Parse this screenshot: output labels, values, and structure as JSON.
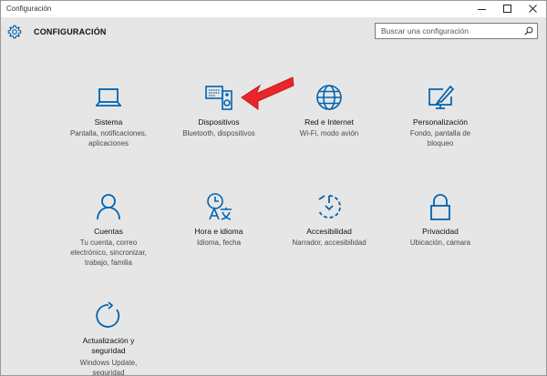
{
  "window": {
    "title": "Configuración"
  },
  "header": {
    "title": "CONFIGURACIÓN",
    "search_placeholder": "Buscar una configuración"
  },
  "colors": {
    "accent": "#0063b1",
    "arrow": "#e8262b"
  },
  "tiles": [
    {
      "icon": "laptop-icon",
      "label": "Sistema",
      "desc": [
        "Pantalla, notificaciones,",
        "aplicaciones"
      ]
    },
    {
      "icon": "devices-icon",
      "label": "Dispositivos",
      "desc": [
        "Bluetooth, dispositivos"
      ]
    },
    {
      "icon": "globe-icon",
      "label": "Red e Internet",
      "desc": [
        "Wi-Fi, modo avión"
      ]
    },
    {
      "icon": "paint-icon",
      "label": "Personalización",
      "desc": [
        "Fondo, pantalla de",
        "bloqueo"
      ]
    },
    {
      "icon": "person-icon",
      "label": "Cuentas",
      "desc": [
        "Tu cuenta, correo",
        "electrónico, sincronizar,",
        "trabajo, familia"
      ]
    },
    {
      "icon": "time-language-icon",
      "label": "Hora e idioma",
      "desc": [
        "Idioma, fecha"
      ]
    },
    {
      "icon": "accessibility-icon",
      "label": "Accesibilidad",
      "desc": [
        "Narrador, accesibilidad"
      ]
    },
    {
      "icon": "lock-icon",
      "label": "Privacidad",
      "desc": [
        "Ubicación, cámara"
      ]
    },
    {
      "icon": "update-icon",
      "label": "Actualización y seguridad",
      "desc": [
        "Windows Update,",
        "seguridad"
      ]
    }
  ]
}
